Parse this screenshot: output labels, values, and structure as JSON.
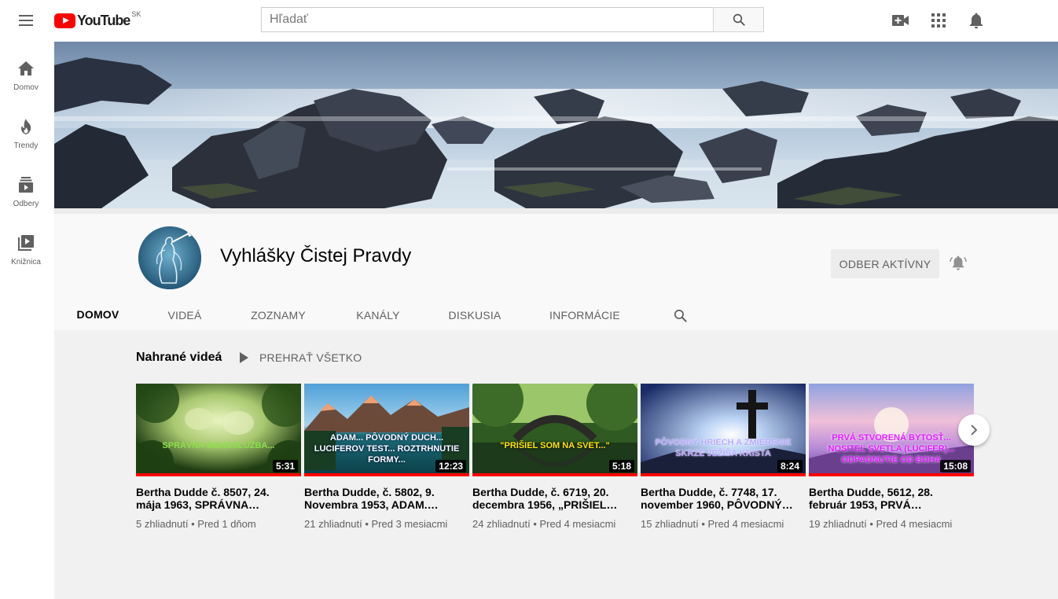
{
  "header": {
    "logo_text": "YouTube",
    "country_code": "SK",
    "search_placeholder": "Hľadať",
    "icons": [
      "menu-icon",
      "search-icon",
      "video-camera-add-icon",
      "apps-grid-icon",
      "bell-icon"
    ]
  },
  "sidebar": {
    "items": [
      {
        "label": "Domov",
        "icon": "home-icon"
      },
      {
        "label": "Trendy",
        "icon": "flame-icon"
      },
      {
        "label": "Odbery",
        "icon": "subscriptions-icon"
      },
      {
        "label": "Knižnica",
        "icon": "library-icon"
      }
    ]
  },
  "channel": {
    "name": "Vyhlášky Čistej Pravdy",
    "subscribe_label": "ODBER AKTÍVNY",
    "tabs": [
      "DOMOV",
      "VIDEÁ",
      "ZOZNAMY",
      "KANÁLY",
      "DISKUSIA",
      "INFORMÁCIE"
    ],
    "active_tab": "DOMOV"
  },
  "shelf": {
    "title": "Nahrané videá",
    "play_all_label": "PREHRAŤ VŠETKO",
    "videos": [
      {
        "title": "Bertha Dudde č. 8507, 24. mája 1963, SPRÁVNA…",
        "duration": "5:31",
        "views": "5 zhliadnutí",
        "age": "Pred 1 dňom",
        "caption": "SPRÁVNA BOHOSLUŽBA...",
        "caption_color": "#8be04a",
        "watched_fraction": 1.0
      },
      {
        "title": "Bertha Dudde, č. 5802, 9. Novembra 1953, ADAM.…",
        "duration": "12:23",
        "views": "21 zhliadnutí",
        "age": "Pred 3 mesiacmi",
        "caption": "ADAM... PÔVODNÝ DUCH... LUCIFEROV TEST... ROZTRHNUTIE FORMY...",
        "caption_color": "#ffffff",
        "watched_fraction": 1.0
      },
      {
        "title": "Bertha Dudde, č. 6719, 20. decembra 1956, „PRIŠIEL…",
        "duration": "5:18",
        "views": "24 zhliadnutí",
        "age": "Pred 4 mesiacmi",
        "caption": "\"PRIŠIEL SOM NA SVET...\"",
        "caption_color": "#ffe600",
        "watched_fraction": 1.0
      },
      {
        "title": "Bertha Dudde, č. 7748, 17. november 1960, PÔVODNÝ…",
        "duration": "8:24",
        "views": "15 zhliadnutí",
        "age": "Pred 4 mesiacmi",
        "caption": "PÔVODNÝ HRIECH A ZMIERENIE SKRZE JEŽIŠA KRISTA",
        "caption_color": "#b9a9ff",
        "watched_fraction": 1.0
      },
      {
        "title": "Bertha Dudde, 5612, 28. február 1953, PRVÁ…",
        "duration": "15:08",
        "views": "19 zhliadnutí",
        "age": "Pred 4 mesiacmi",
        "caption": "PRVÁ STVORENÁ BYTOSŤ... NOSITEĽ SVETLA (LUCIFER)... ODPADNUTIE OD BOHA",
        "caption_color": "#e11cff",
        "watched_fraction": 1.0
      }
    ]
  },
  "colors": {
    "youtube_red": "#ff0000",
    "progress_red": "#ff0000",
    "content_bg": "#f1f1f1"
  }
}
